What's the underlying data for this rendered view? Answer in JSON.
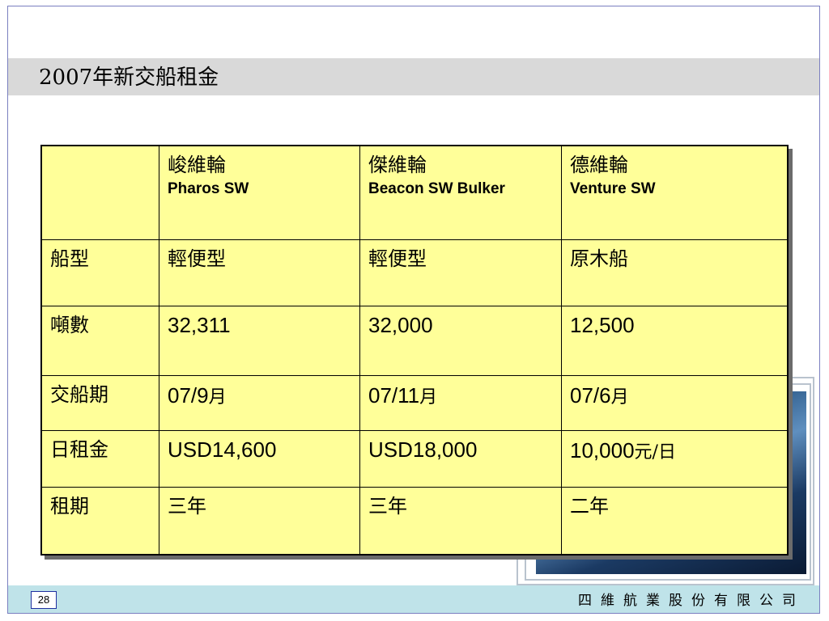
{
  "slide": {
    "title": "2007年新交船租金",
    "page_number": "28",
    "company": "四維航業股份有限公司"
  },
  "table": {
    "header": [
      {
        "zh": "",
        "en": ""
      },
      {
        "zh": "峻維輪",
        "en": "Pharos SW"
      },
      {
        "zh": "傑維輪",
        "en": "Beacon SW Bulker"
      },
      {
        "zh": "德維輪",
        "en": "Venture SW"
      }
    ],
    "rows": [
      {
        "label": "船型",
        "cells": [
          "輕便型",
          "輕便型",
          "原木船"
        ]
      },
      {
        "label": "噸數",
        "cells": [
          "32,311",
          "32,000",
          "12,500"
        ]
      },
      {
        "label": "交船期",
        "cells": [
          {
            "num": "07/9",
            "unit": "月"
          },
          {
            "num": "07/11",
            "unit": "月"
          },
          {
            "num": "07/6",
            "unit": "月"
          }
        ]
      },
      {
        "label": "日租金",
        "cells": [
          {
            "num": "USD14,600",
            "unit": ""
          },
          {
            "num": "USD18,000",
            "unit": ""
          },
          {
            "num": "10,000",
            "unit": "元/日"
          }
        ]
      },
      {
        "label": "租期",
        "cells": [
          "三年",
          "三年",
          "二年"
        ]
      }
    ]
  }
}
